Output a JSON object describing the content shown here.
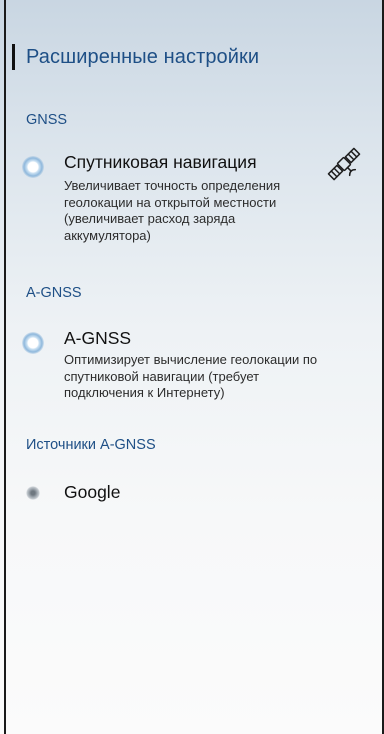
{
  "header": {
    "title": "Расширенные настройки"
  },
  "sections": [
    {
      "title": "GNSS",
      "item": {
        "title": "Спутниковая навигация",
        "desc_lines": [
          "Увеличивает точность определения",
          "геолокации на открытой местности",
          "(увеличивает расход заряда",
          "аккумулятора)"
        ],
        "icon": "satellite-icon",
        "enabled": true
      }
    },
    {
      "title": "A-GNSS",
      "item": {
        "title": "A-GNSS",
        "desc_lines": [
          "Оптимизирует вычисление геолокации по",
          "спутниковой навигации (требует",
          "подключения к Интернету)"
        ],
        "enabled": true
      }
    },
    {
      "title": "Источники A-GNSS",
      "item": {
        "title": "Google",
        "enabled": false
      }
    }
  ],
  "colors": {
    "accent": "#1e4f86",
    "text": "#111111"
  }
}
